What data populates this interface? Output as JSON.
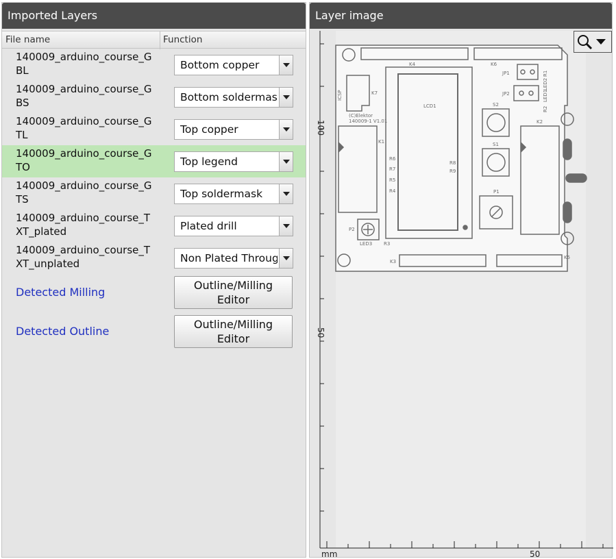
{
  "left_panel": {
    "title": "Imported Layers",
    "columns": {
      "file_name": "File name",
      "function": "Function"
    },
    "layers": [
      {
        "file": "140009_arduino_course_GBL",
        "function": "Bottom copper",
        "selected": false
      },
      {
        "file": "140009_arduino_course_GBS",
        "function": "Bottom soldermask",
        "selected": false
      },
      {
        "file": "140009_arduino_course_GTL",
        "function": "Top copper",
        "selected": false
      },
      {
        "file": "140009_arduino_course_GTO",
        "function": "Top legend",
        "selected": true
      },
      {
        "file": "140009_arduino_course_GTS",
        "function": "Top soldermask",
        "selected": false
      },
      {
        "file": "140009_arduino_course_TXT_plated",
        "function": "Plated drill",
        "selected": false
      },
      {
        "file": "140009_arduino_course_TXT_unplated",
        "function": "Non Plated Through",
        "selected": false
      }
    ],
    "detected": [
      {
        "label": "Detected Milling",
        "button": "Outline/Milling Editor"
      },
      {
        "label": "Detected Outline",
        "button": "Outline/Milling Editor"
      }
    ]
  },
  "right_panel": {
    "title": "Layer image",
    "zoom_icon": "magnifier-icon",
    "dropdown_icon": "chevron-down-icon",
    "ruler": {
      "unit": "mm",
      "x_labels": [
        "50"
      ],
      "y_labels": [
        "100",
        "50"
      ]
    },
    "pcb": {
      "component_labels": [
        "K4",
        "K6",
        "K7",
        "ICSP",
        "LCD1",
        "JP1",
        "JP2",
        "R1",
        "LED2",
        "LED1",
        "R2",
        "S2",
        "S1",
        "K1",
        "K2",
        "P1",
        "P2",
        "LED3",
        "R3",
        "K3",
        "K5",
        "R6",
        "R7",
        "R5",
        "R4",
        "R8",
        "R9"
      ],
      "credit_lines": [
        "(C)Elektor",
        "140009-1 V1.01"
      ]
    }
  }
}
